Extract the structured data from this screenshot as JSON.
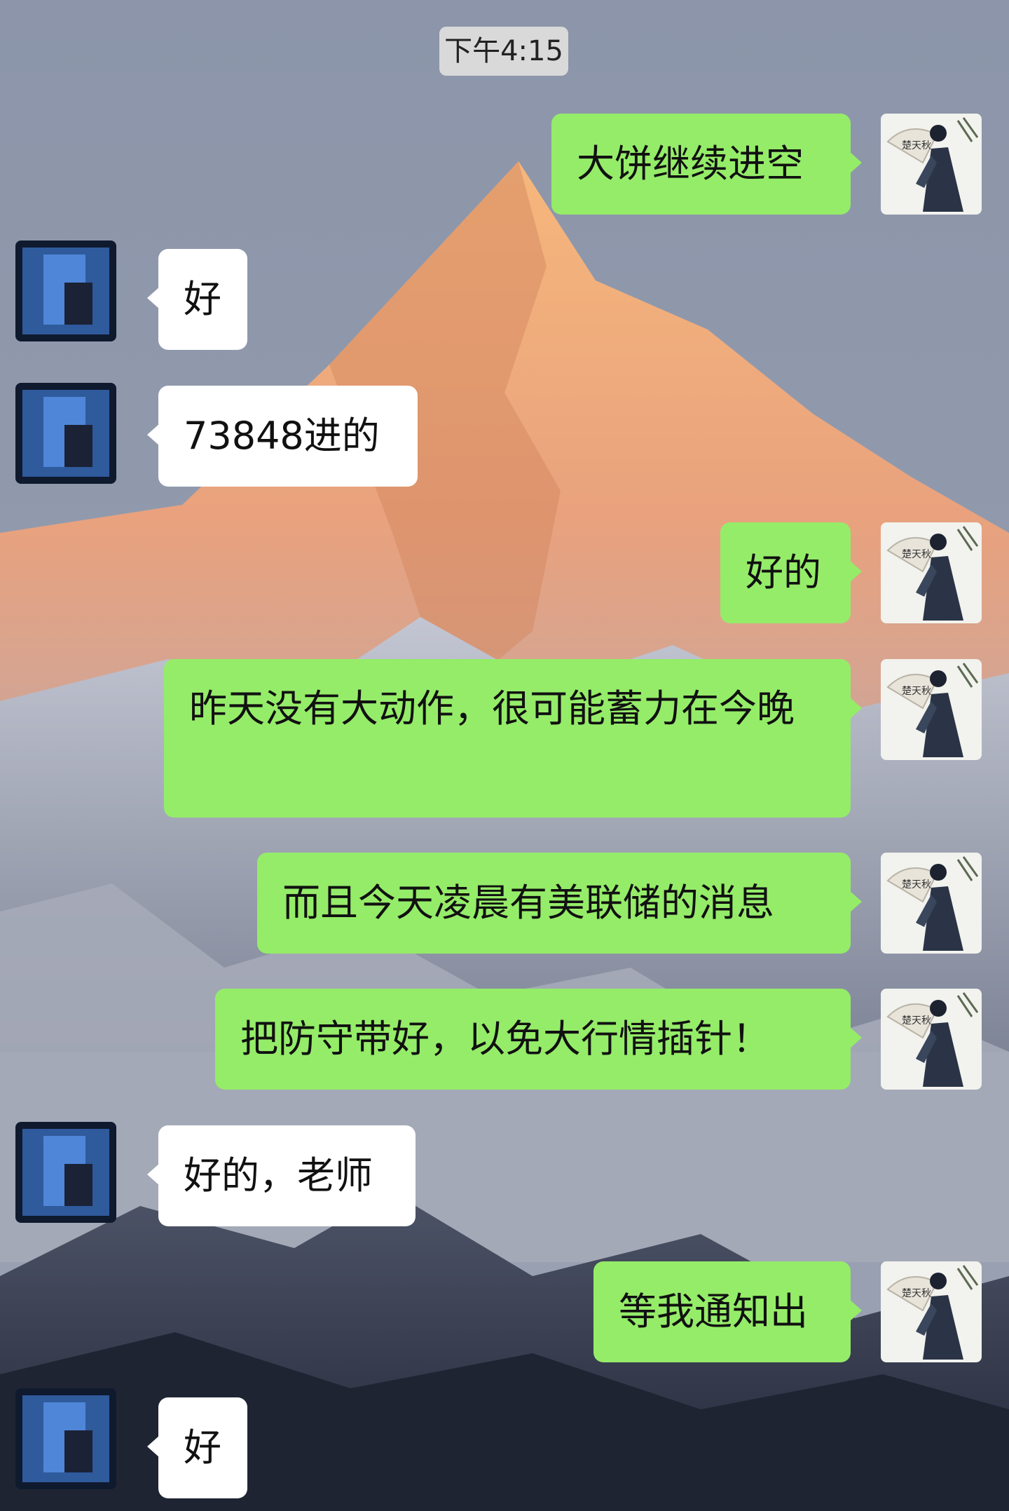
{
  "timestamp": "下午4:15",
  "messages": [
    {
      "side": "out",
      "text": "大饼继续进空"
    },
    {
      "side": "in",
      "text": "好"
    },
    {
      "side": "in",
      "text": "73848进的"
    },
    {
      "side": "out",
      "text": "好的"
    },
    {
      "side": "out",
      "text": "昨天没有大动作，很可能蓄力在今晚"
    },
    {
      "side": "out",
      "text": "而且今天凌晨有美联储的消息"
    },
    {
      "side": "out",
      "text": "把防守带好，以免大行情插针！"
    },
    {
      "side": "in",
      "text": "好的，老师"
    },
    {
      "side": "out",
      "text": "等我通知出"
    },
    {
      "side": "in",
      "text": "好"
    }
  ],
  "avatar_self": {
    "icon": "scholar-fan-avatar-icon",
    "fan_text": "楚天秋"
  },
  "avatar_other": {
    "icon": "blurred-blue-avatar-icon"
  },
  "colors": {
    "outgoing_bubble": "#95ec69",
    "incoming_bubble": "#ffffff",
    "time_chip": "#d9d9d9"
  }
}
